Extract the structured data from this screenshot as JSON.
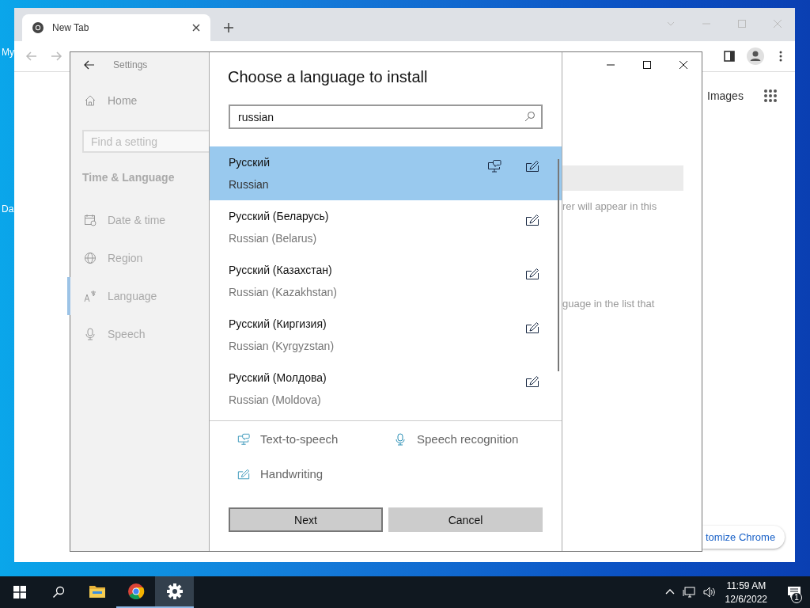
{
  "desktop": {
    "icon_labels": [
      "My",
      "Da"
    ]
  },
  "browser": {
    "tab": {
      "title": "New Tab"
    },
    "content": {
      "link": "Images",
      "customize_button": "tomize Chrome"
    }
  },
  "settings": {
    "title": "Settings",
    "home": "Home",
    "search": {
      "placeholder": "Find a setting"
    },
    "section": "Time & Language",
    "nav": [
      {
        "kind": "calendar",
        "label": "Date & time",
        "selected": false
      },
      {
        "kind": "globe",
        "label": "Region",
        "selected": false
      },
      {
        "kind": "language",
        "label": "Language",
        "selected": true
      },
      {
        "kind": "microphone",
        "label": "Speech",
        "selected": false
      }
    ],
    "background_texts": [
      "rer will appear in this",
      "guage in the list that"
    ]
  },
  "dialog": {
    "title": "Choose a language to install",
    "search": {
      "value": "russian"
    },
    "languages": [
      {
        "native": "Русский",
        "english": "Russian",
        "text_to_speech": true,
        "handwriting": true,
        "selected": true
      },
      {
        "native": "Русский (Беларусь)",
        "english": "Russian (Belarus)",
        "text_to_speech": false,
        "handwriting": true,
        "selected": false
      },
      {
        "native": "Русский (Казахстан)",
        "english": "Russian (Kazakhstan)",
        "text_to_speech": false,
        "handwriting": true,
        "selected": false
      },
      {
        "native": "Русский (Киргизия)",
        "english": "Russian (Kyrgyzstan)",
        "text_to_speech": false,
        "handwriting": true,
        "selected": false
      },
      {
        "native": "Русский (Молдова)",
        "english": "Russian (Moldova)",
        "text_to_speech": false,
        "handwriting": true,
        "selected": false
      }
    ],
    "legend": [
      {
        "kind": "tts",
        "label": "Text-to-speech"
      },
      {
        "kind": "microphone",
        "label": "Speech recognition"
      },
      {
        "kind": "handwriting",
        "label": "Handwriting"
      }
    ],
    "buttons": [
      {
        "label": "Next",
        "focused": true
      },
      {
        "label": "Cancel",
        "focused": false
      }
    ]
  },
  "taskbar": {
    "apps": [
      {
        "kind": "explorer",
        "running": false,
        "selected": false
      },
      {
        "kind": "chrome",
        "running": true,
        "selected": false
      },
      {
        "kind": "settings",
        "running": true,
        "selected": true
      }
    ],
    "time": "11:59 AM",
    "date": "12/6/2022",
    "notifications": "1"
  }
}
